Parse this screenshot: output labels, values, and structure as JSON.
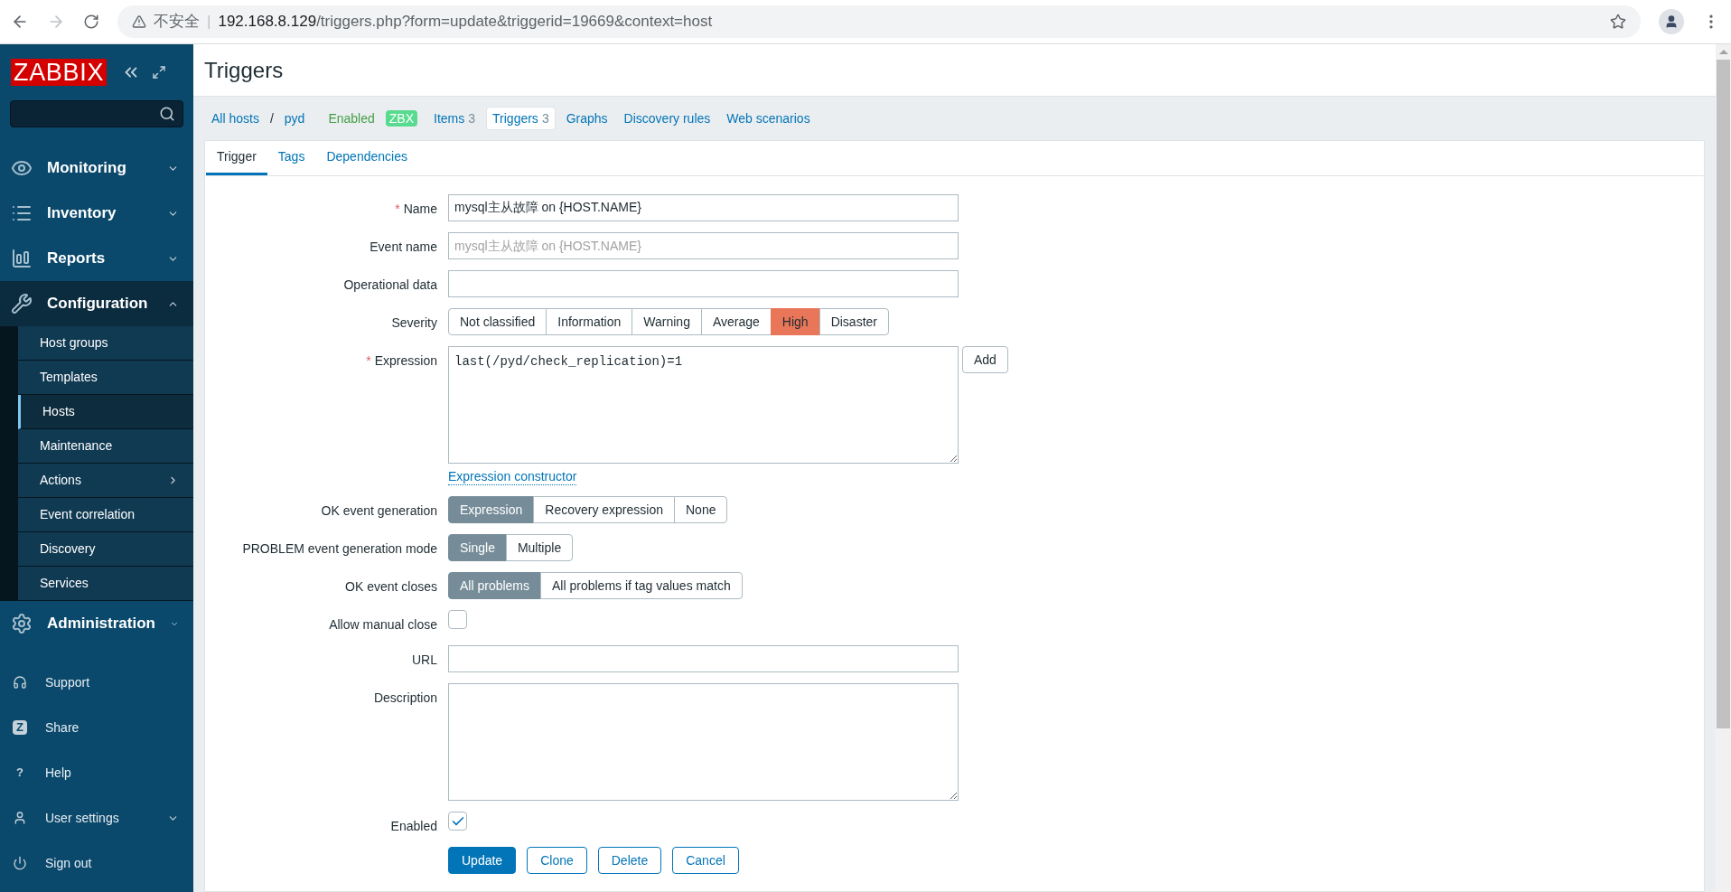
{
  "browser": {
    "security": "不安全",
    "separator": "|",
    "url_host": "192.168.8.129",
    "url_path": "/triggers.php?form=update&triggerid=19669&context=host"
  },
  "sidebar": {
    "logo": "ZABBIX",
    "menu": [
      {
        "label": "Monitoring",
        "expanded": false
      },
      {
        "label": "Inventory",
        "expanded": false
      },
      {
        "label": "Reports",
        "expanded": false
      },
      {
        "label": "Configuration",
        "expanded": true,
        "children": [
          {
            "label": "Host groups",
            "selected": false,
            "submenu": false
          },
          {
            "label": "Templates",
            "selected": false,
            "submenu": false
          },
          {
            "label": "Hosts",
            "selected": true,
            "submenu": false
          },
          {
            "label": "Maintenance",
            "selected": false,
            "submenu": false
          },
          {
            "label": "Actions",
            "selected": false,
            "submenu": true
          },
          {
            "label": "Event correlation",
            "selected": false,
            "submenu": false
          },
          {
            "label": "Discovery",
            "selected": false,
            "submenu": false
          },
          {
            "label": "Services",
            "selected": false,
            "submenu": false
          }
        ]
      },
      {
        "label": "Administration",
        "expanded": false
      }
    ],
    "bottom": [
      {
        "label": "Support",
        "has_menu": false
      },
      {
        "label": "Share",
        "has_menu": false,
        "glyph": "Z"
      },
      {
        "label": "Help",
        "has_menu": false,
        "glyph": "?"
      },
      {
        "label": "User settings",
        "has_menu": true
      },
      {
        "label": "Sign out",
        "has_menu": false
      }
    ]
  },
  "page_title": "Triggers",
  "required_mark": "*",
  "host_nav": {
    "breadcrumbs": [
      "All hosts",
      "pyd"
    ],
    "separator": "/",
    "status": "Enabled",
    "badge": "ZBX",
    "links": [
      {
        "label": "Items",
        "count": "3",
        "selected": false
      },
      {
        "label": "Triggers",
        "count": "3",
        "selected": true
      },
      {
        "label": "Graphs",
        "selected": false
      },
      {
        "label": "Discovery rules",
        "selected": false
      },
      {
        "label": "Web scenarios",
        "selected": false
      }
    ]
  },
  "tabs": [
    {
      "label": "Trigger",
      "selected": true
    },
    {
      "label": "Tags",
      "selected": false
    },
    {
      "label": "Dependencies",
      "selected": false
    }
  ],
  "form": [
    {
      "kind": "input",
      "label": "Name",
      "required": true,
      "value": "mysql主从故障 on {HOST.NAME}"
    },
    {
      "kind": "input",
      "label": "Event name",
      "required": false,
      "placeholder": "mysql主从故障 on {HOST.NAME}"
    },
    {
      "kind": "input",
      "label": "Operational data",
      "required": false
    },
    {
      "kind": "severity",
      "label": "Severity",
      "required": false,
      "options": [
        {
          "label": "Not classified",
          "selected": false
        },
        {
          "label": "Information",
          "selected": false
        },
        {
          "label": "Warning",
          "selected": false
        },
        {
          "label": "Average",
          "selected": false
        },
        {
          "label": "High",
          "selected": true
        },
        {
          "label": "Disaster",
          "selected": false
        }
      ]
    },
    {
      "kind": "expression",
      "label": "Expression",
      "required": true,
      "value": "last(/pyd/check_replication)=1",
      "button": "Add",
      "link": "Expression constructor"
    },
    {
      "kind": "segmented",
      "label": "OK event generation",
      "required": false,
      "options": [
        {
          "label": "Expression",
          "selected": true
        },
        {
          "label": "Recovery expression",
          "selected": false
        },
        {
          "label": "None",
          "selected": false
        }
      ]
    },
    {
      "kind": "segmented",
      "label": "PROBLEM event generation mode",
      "required": false,
      "options": [
        {
          "label": "Single",
          "selected": true
        },
        {
          "label": "Multiple",
          "selected": false
        }
      ]
    },
    {
      "kind": "segmented",
      "label": "OK event closes",
      "required": false,
      "options": [
        {
          "label": "All problems",
          "selected": true
        },
        {
          "label": "All problems if tag values match",
          "selected": false
        }
      ]
    },
    {
      "kind": "checkbox",
      "label": "Allow manual close",
      "required": false,
      "checked": false
    },
    {
      "kind": "input",
      "label": "URL",
      "required": false
    },
    {
      "kind": "textarea",
      "label": "Description",
      "required": false
    },
    {
      "kind": "checkbox",
      "label": "Enabled",
      "required": false,
      "checked": true
    }
  ],
  "buttons": [
    {
      "label": "Update",
      "primary": true
    },
    {
      "label": "Clone",
      "primary": false
    },
    {
      "label": "Delete",
      "primary": false
    },
    {
      "label": "Cancel",
      "primary": false
    }
  ]
}
